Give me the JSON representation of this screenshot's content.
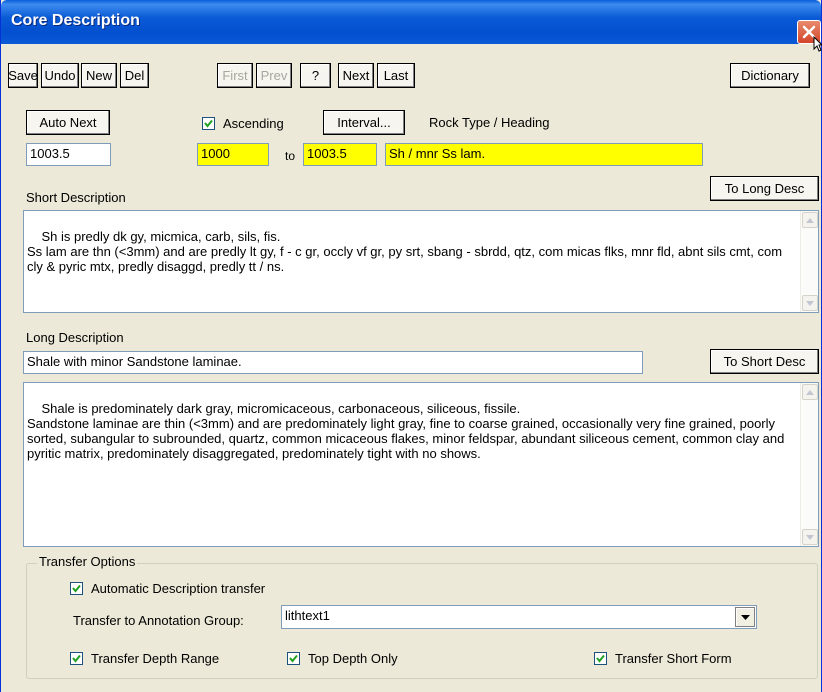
{
  "window": {
    "title": "Core Description"
  },
  "toolbar": {
    "save": "Save",
    "undo": "Undo",
    "new": "New",
    "del": "Del",
    "first": "First",
    "prev": "Prev",
    "help": "?",
    "next": "Next",
    "last": "Last",
    "dictionary": "Dictionary"
  },
  "controls": {
    "auto_next": "Auto Next",
    "ascending_label": "Ascending",
    "ascending_checked": true,
    "interval_button": "Interval...",
    "rock_type_label": "Rock Type / Heading"
  },
  "depth": {
    "current": "1003.5",
    "from": "1000",
    "to_label": "to",
    "to": "1003.5",
    "rock_type": "Sh / mnr Ss lam."
  },
  "short_description": {
    "label": "Short Description",
    "to_long_button": "To Long Desc",
    "text": "Sh is predly dk gy, micmica, carb, sils, fis.\nSs lam are thn (<3mm) and are predly lt gy, f - c gr, occly vf gr, py srt, sbang - sbrdd, qtz, com micas flks, mnr fld, abnt sils cmt, com cly & pyric mtx, predly disaggd, predly tt / ns."
  },
  "long_description": {
    "label": "Long Description",
    "heading": "Shale with minor Sandstone laminae.",
    "to_short_button": "To Short Desc",
    "text": "Shale is predominately dark gray, micromicaceous, carbonaceous, siliceous, fissile.\nSandstone laminae are thin (<3mm) and are predominately light gray, fine to coarse grained, occasionally very fine grained, poorly sorted, subangular to subrounded, quartz, common micaceous flakes, minor feldspar, abundant siliceous cement, common clay and pyritic matrix, predominately disaggregated, predominately tight with no shows."
  },
  "transfer": {
    "group_title": "Transfer Options",
    "automatic_label": "Automatic Description transfer",
    "automatic_checked": true,
    "annotation_group_label": "Transfer to Annotation Group:",
    "annotation_group_value": "lithtext1",
    "depth_range_label": "Transfer Depth Range",
    "depth_range_checked": true,
    "top_depth_label": "Top Depth Only",
    "top_depth_checked": true,
    "short_form_label": "Transfer Short Form",
    "short_form_checked": true
  },
  "icons": {
    "close": "close-icon",
    "checkmark": "checkmark-icon",
    "scroll_up": "scroll-up-arrow-icon",
    "scroll_down": "scroll-down-arrow-icon",
    "dropdown": "dropdown-arrow-icon",
    "cursor": "mouse-pointer-icon"
  },
  "colors": {
    "titlebar": "#0a5ad6",
    "highlight_field": "#ffff00",
    "window_bg": "#ece9d8"
  }
}
